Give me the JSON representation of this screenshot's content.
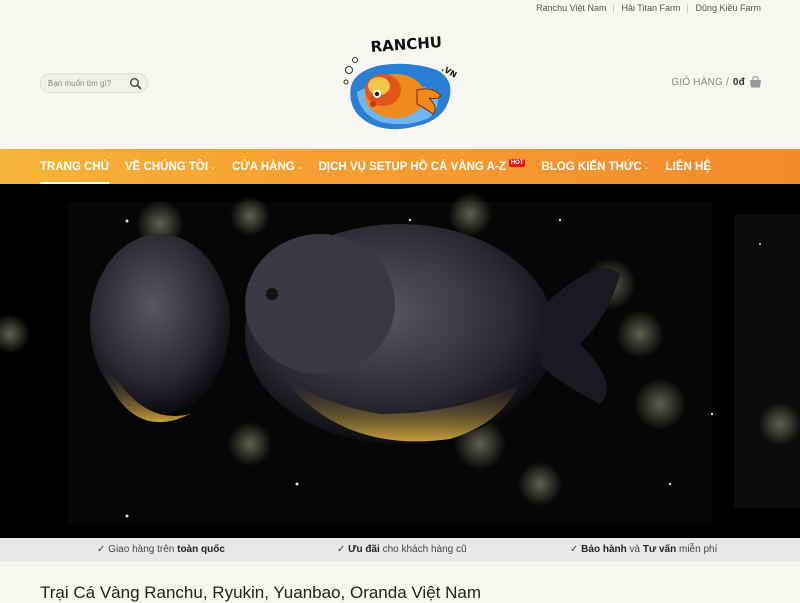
{
  "topbar": {
    "links": [
      "Ranchu Việt Nam",
      "Hải Titan Farm",
      "Dũng Kiều Farm"
    ]
  },
  "header": {
    "search_placeholder": "Bạn muốn tìm gì?",
    "logo_text": "RANCHU.VN",
    "cart_label": "GIỎ HÀNG /",
    "cart_amount": "0đ"
  },
  "nav": {
    "items": [
      {
        "label": "TRANG CHỦ",
        "active": true
      },
      {
        "label": "VỀ CHÚNG TÔI"
      },
      {
        "label": "CỬA HÀNG"
      },
      {
        "label": "DỊCH VỤ SETUP HỒ CÁ VÀNG A-Z"
      },
      {
        "label": "BLOG KIẾN THỨC"
      },
      {
        "label": "LIÊN HỆ"
      }
    ],
    "hot_badge": "HOT"
  },
  "usp": {
    "items": [
      {
        "pre": "Giao hàng trên ",
        "bold": "toàn quốc",
        "post": ""
      },
      {
        "pre": "",
        "bold": "Ưu đãi",
        "post": " cho khách hàng cũ"
      },
      {
        "pre": "",
        "bold": "Bảo hành",
        "mid": " và ",
        "bold2": "Tư vấn",
        "post": " miễn phí"
      }
    ]
  },
  "intro": {
    "title": "Trại Cá Vàng Ranchu, Ryukin, Yuanbao, Oranda Việt Nam"
  },
  "colors": {
    "nav_start": "#f6b43a",
    "nav_end": "#f48a2c",
    "hot_badge": "#e01818",
    "background": "#f7f6f2"
  },
  "icons": [
    "search-icon",
    "cart-bag-icon",
    "chevron-down-icon",
    "checkmark-icon"
  ]
}
